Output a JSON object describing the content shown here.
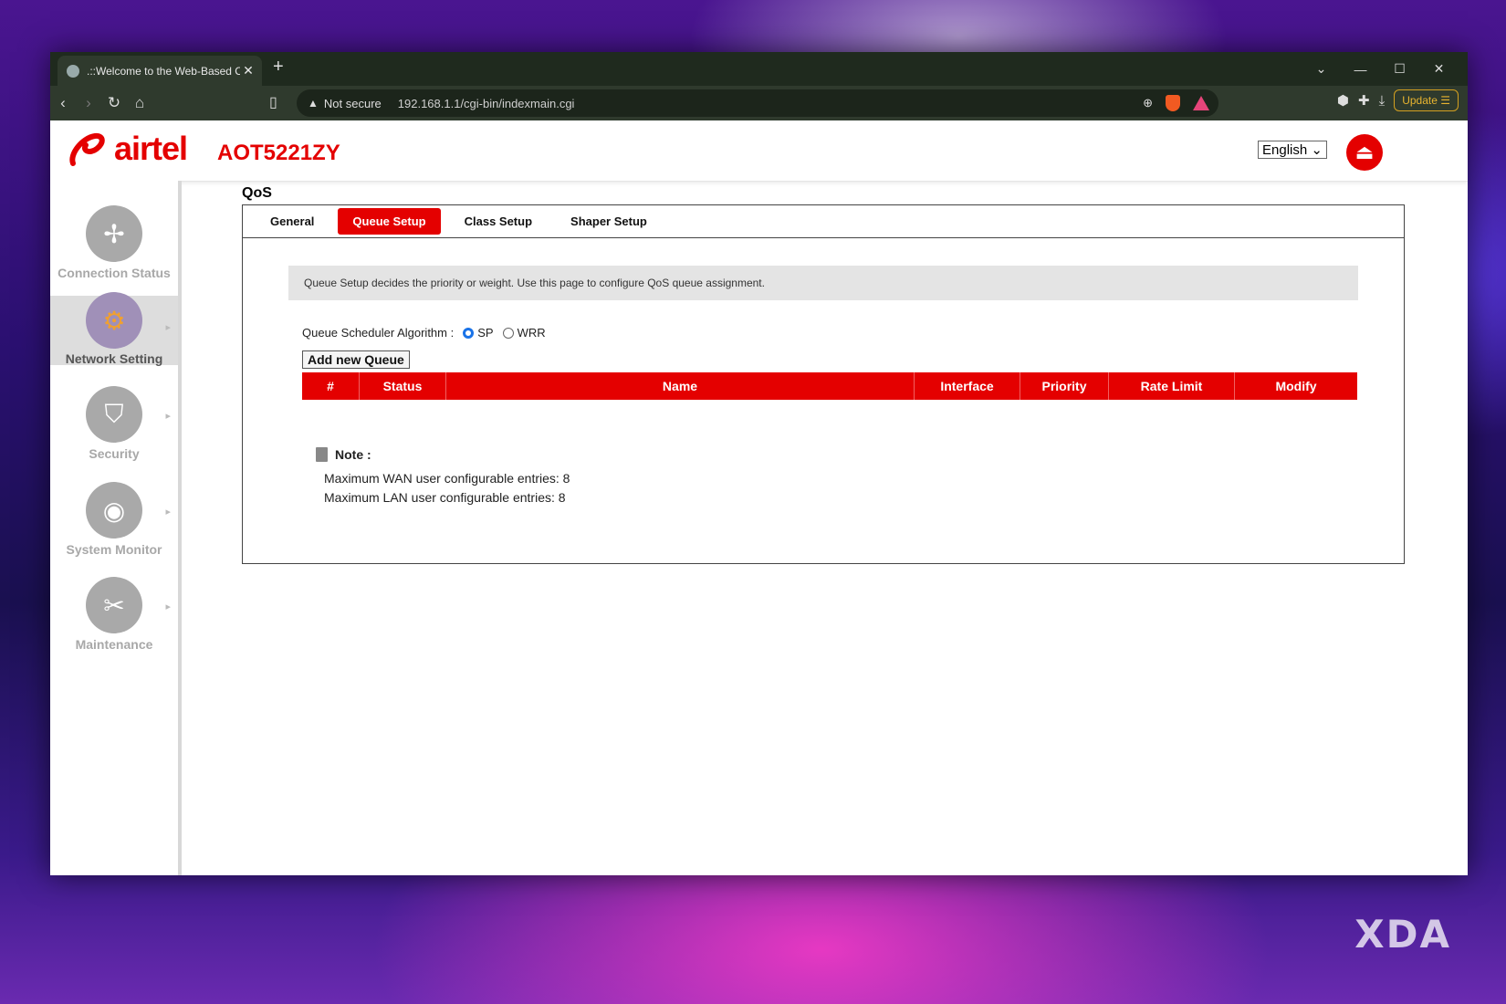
{
  "browser": {
    "tab_title": ".::Welcome to the Web-Based Co",
    "tab_close": "✕",
    "new_tab": "+",
    "security_label": "Not secure",
    "url": "192.168.1.1/cgi-bin/indexmain.cgi",
    "update_label": "Update"
  },
  "header": {
    "brand": "airtel",
    "model": "AOT5221ZY",
    "language": "English"
  },
  "sidebar": {
    "items": [
      {
        "label": "Connection Status"
      },
      {
        "label": "Network Setting"
      },
      {
        "label": "Security"
      },
      {
        "label": "System Monitor"
      },
      {
        "label": "Maintenance"
      }
    ]
  },
  "main": {
    "title": "QoS",
    "tabs": [
      {
        "label": "General"
      },
      {
        "label": "Queue Setup"
      },
      {
        "label": "Class Setup"
      },
      {
        "label": "Shaper Setup"
      }
    ],
    "description": "Queue Setup decides the priority or weight. Use this page to configure QoS queue assignment.",
    "algorithm_label": "Queue Scheduler Algorithm :",
    "algorithm_options": [
      "SP",
      "WRR"
    ],
    "algorithm_selected": "SP",
    "add_button": "Add new Queue",
    "table_headers": [
      "#",
      "Status",
      "Name",
      "Interface",
      "Priority",
      "Rate Limit",
      "Modify"
    ],
    "note_title": "Note :",
    "note_lines": [
      "Maximum WAN user configurable entries: 8",
      "Maximum LAN user configurable entries: 8"
    ]
  },
  "watermark": "XDA",
  "colors": {
    "accent": "#e40000",
    "active_tab": "#e40000"
  }
}
